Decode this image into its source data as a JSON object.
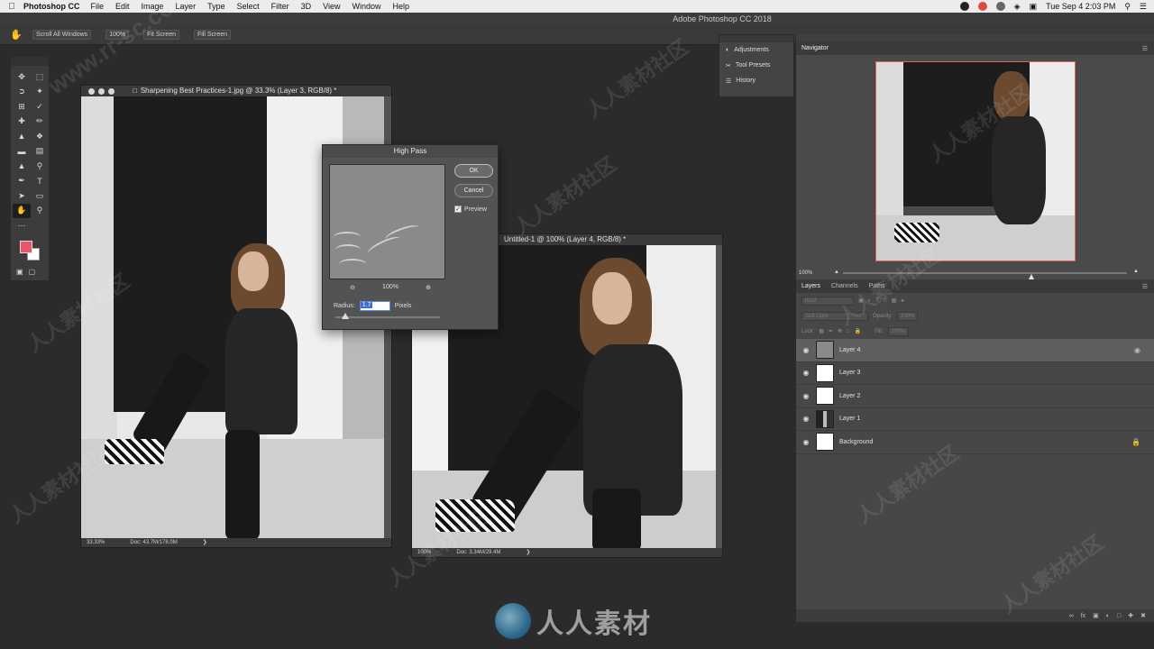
{
  "menubar": {
    "app_name": "Photoshop CC",
    "items": [
      "File",
      "Edit",
      "Image",
      "Layer",
      "Type",
      "Select",
      "Filter",
      "3D",
      "View",
      "Window",
      "Help"
    ],
    "clock": "Tue Sep 4  2:03 PM"
  },
  "app_title": "Adobe Photoshop CC 2018",
  "options_bar": {
    "scroll_all": "Scroll All Windows",
    "zoom_value": "100%",
    "fit_screen": "Fit Screen",
    "fill_screen": "Fill Screen"
  },
  "doc1": {
    "title": "Sharpening Best Practices-1.jpg @ 33.3% (Layer 3, RGB/8) *",
    "zoom": "33.33%",
    "doc_info": "Doc: 43.7M/178.0M"
  },
  "doc2": {
    "title": "Untitled-1 @ 100% (Layer 4, RGB/8) *",
    "zoom": "100%",
    "doc_info": "Doc: 3.34M/29.4M"
  },
  "dialog": {
    "title": "High Pass",
    "ok": "OK",
    "cancel": "Cancel",
    "preview_label": "Preview",
    "zoom": "100%",
    "radius_label": "Radius:",
    "radius_value": "1.7",
    "units": "Pixels"
  },
  "collapsed_panels": [
    "Adjustments",
    "Tool Presets",
    "History"
  ],
  "navigator": {
    "tab": "Navigator",
    "zoom": "100%"
  },
  "layers_panel": {
    "tabs": [
      "Layers",
      "Channels",
      "Paths"
    ],
    "kind_placeholder": "Kind",
    "blend_mode": "Soft Light",
    "opacity_label": "Opacity:",
    "opacity_value": "100%",
    "lock_label": "Lock:",
    "fill_label": "Fill:",
    "fill_value": "100%",
    "layers": [
      {
        "name": "Layer 4"
      },
      {
        "name": "Layer 3"
      },
      {
        "name": "Layer 2"
      },
      {
        "name": "Layer 1"
      },
      {
        "name": "Background"
      }
    ]
  },
  "watermark": {
    "brand": "人人素材",
    "repeat_text": "人人素材社区",
    "url": "www.rr-sc.com"
  }
}
